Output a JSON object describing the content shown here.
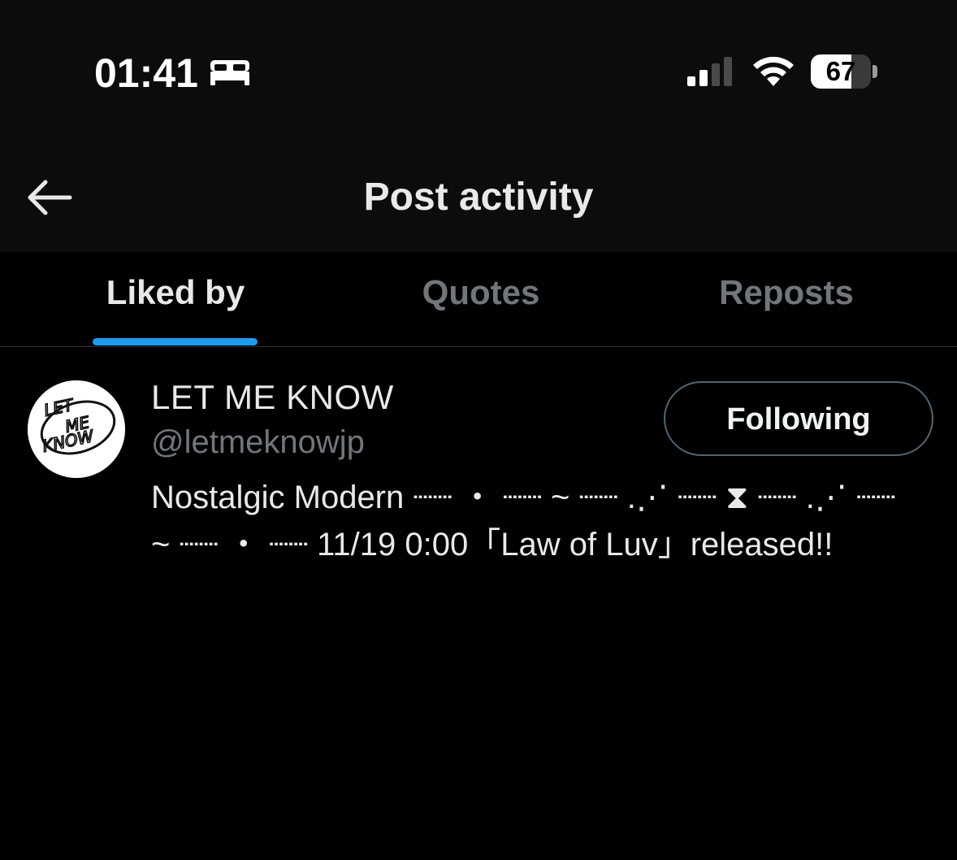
{
  "status_bar": {
    "time": "01:41",
    "focus_icon": "bed-icon",
    "signal_icon": "cellular-signal-icon",
    "wifi_icon": "wifi-icon",
    "battery_level": "67",
    "battery_fraction": 0.67
  },
  "header": {
    "back_icon": "arrow-left-icon",
    "title": "Post activity"
  },
  "tabs": [
    {
      "label": "Liked by",
      "active": true
    },
    {
      "label": "Quotes",
      "active": false
    },
    {
      "label": "Reposts",
      "active": false
    }
  ],
  "accent_color": "#1d9bf0",
  "users": [
    {
      "display_name": "LET ME KNOW",
      "handle": "@letmeknowjp",
      "avatar_text": [
        "LET",
        "ME",
        "KNOW"
      ],
      "follow_label": "Following",
      "bio": "Nostalgic Modern ┈┈ ・ ┈┈ ~ ┈┈ .⋰ ┈┈ ⧗ ┈┈ .⋰ ┈┈\n~ ┈┈ ・ ┈┈ 11/19 0:00「Law of Luv」released!!"
    }
  ]
}
